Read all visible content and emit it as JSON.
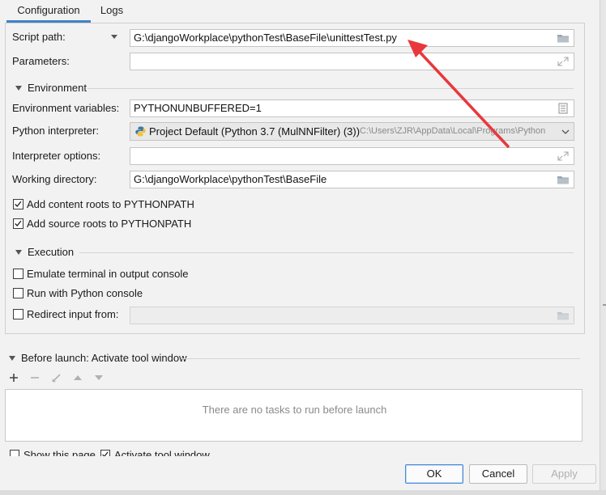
{
  "tabs": {
    "configuration": "Configuration",
    "logs": "Logs"
  },
  "script_path": {
    "label": "Script path:",
    "value": "G:\\djangoWorkplace\\pythonTest\\BaseFile\\unittestTest.py"
  },
  "parameters": {
    "label": "Parameters:",
    "value": ""
  },
  "environment": {
    "section": "Environment",
    "env_vars_label": "Environment variables:",
    "env_vars_value": "PYTHONUNBUFFERED=1",
    "interpreter_label": "Python interpreter:",
    "interpreter_name": "Project Default (Python 3.7 (MulNNFilter) (3))",
    "interpreter_path": "C:\\Users\\ZJR\\AppData\\Local\\Programs\\Python",
    "interpreter_options_label": "Interpreter options:",
    "interpreter_options_value": "",
    "working_dir_label": "Working directory:",
    "working_dir_value": "G:\\djangoWorkplace\\pythonTest\\BaseFile",
    "add_content_roots": "Add content roots to PYTHONPATH",
    "add_source_roots": "Add source roots to PYTHONPATH"
  },
  "execution": {
    "section": "Execution",
    "emulate_terminal": "Emulate terminal in output console",
    "run_with_console": "Run with Python console",
    "redirect_input": "Redirect input from:",
    "redirect_value": ""
  },
  "before_launch": {
    "section": "Before launch: Activate tool window",
    "empty_text": "There are no tasks to run before launch"
  },
  "footer": {
    "show_this_page": "Show this page",
    "activate_tool_window": "Activate tool window"
  },
  "buttons": {
    "ok": "OK",
    "cancel": "Cancel",
    "apply": "Apply"
  },
  "checkbox_state": {
    "add_content_roots": true,
    "add_source_roots": true,
    "emulate_terminal": false,
    "run_with_console": false,
    "redirect_input": false,
    "show_this_page": false,
    "activate_tool_window": true
  },
  "colors": {
    "accent": "#4083c9",
    "annotation_arrow": "#e8383d",
    "panel_bg": "#f2f2f2"
  },
  "icons": [
    "folder-icon",
    "expand-icon",
    "list-icon",
    "python-icon",
    "chevron-down-icon",
    "add-icon",
    "remove-icon",
    "edit-icon",
    "move-up-icon",
    "move-down-icon"
  ]
}
